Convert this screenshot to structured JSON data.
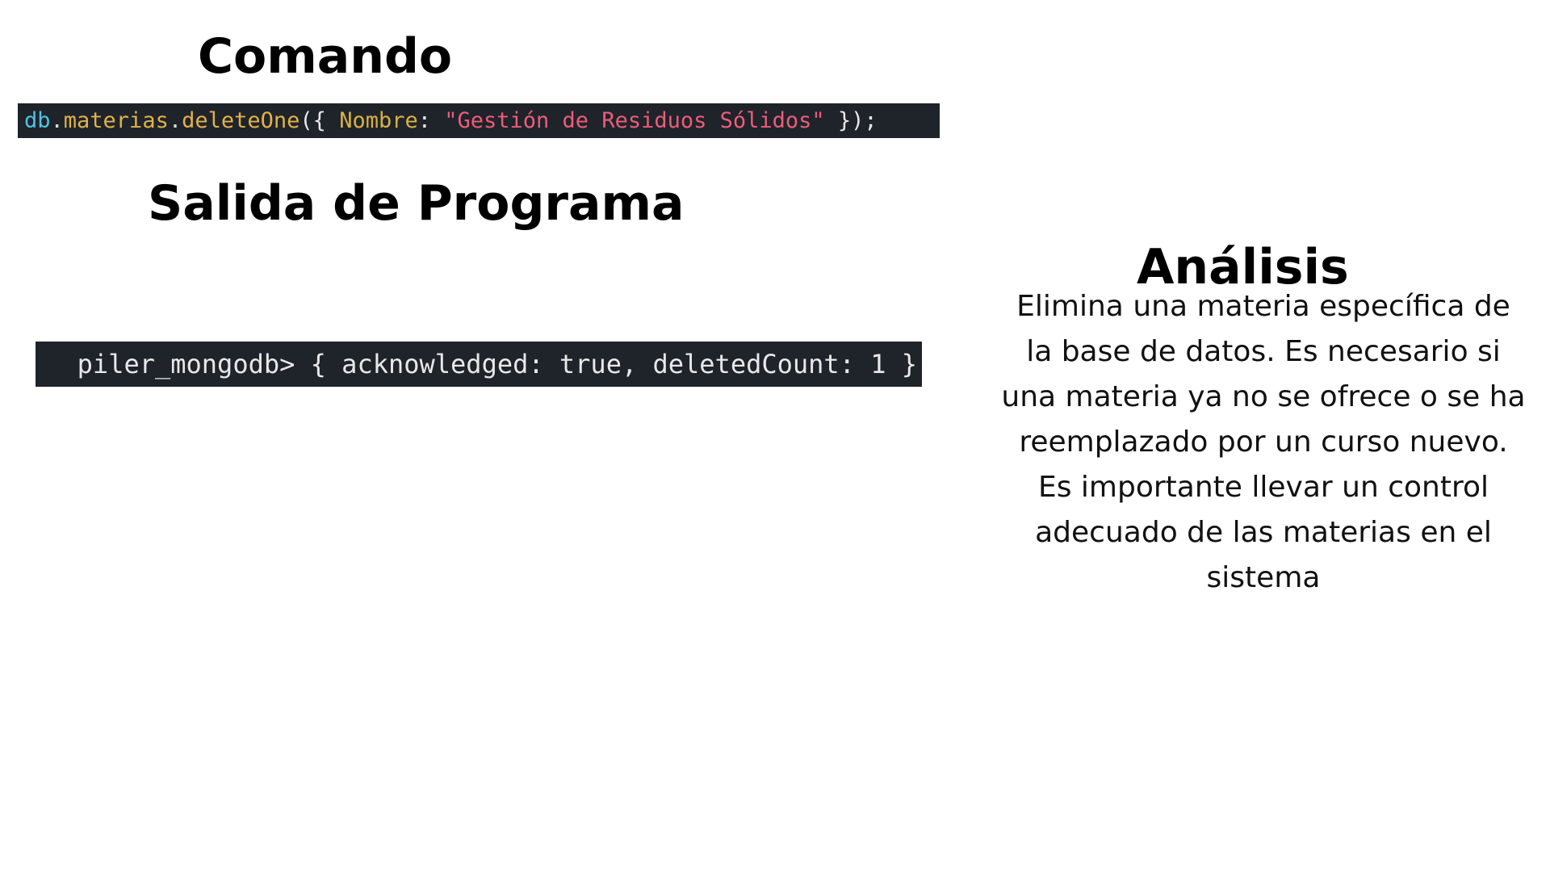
{
  "command_section": {
    "heading": "Comando",
    "code": {
      "db": "db",
      "dot1": ".",
      "collection": "materias",
      "dot2": ".",
      "method": "deleteOne",
      "open": "({ ",
      "key": "Nombre",
      "colon": ": ",
      "value": "\"Gestión de Residuos Sólidos\"",
      "close": " });"
    }
  },
  "output_section": {
    "heading": "Salida de Programa",
    "text": "piler_mongodb> { acknowledged: true, deletedCount: 1 }"
  },
  "analysis_section": {
    "heading": "Análisis",
    "body": "Elimina una materia específica de la base de datos. Es necesario si una materia ya no se ofrece o se ha reemplazado por un curso nuevo. Es importante llevar un control adecuado de las materias en el sistema"
  }
}
